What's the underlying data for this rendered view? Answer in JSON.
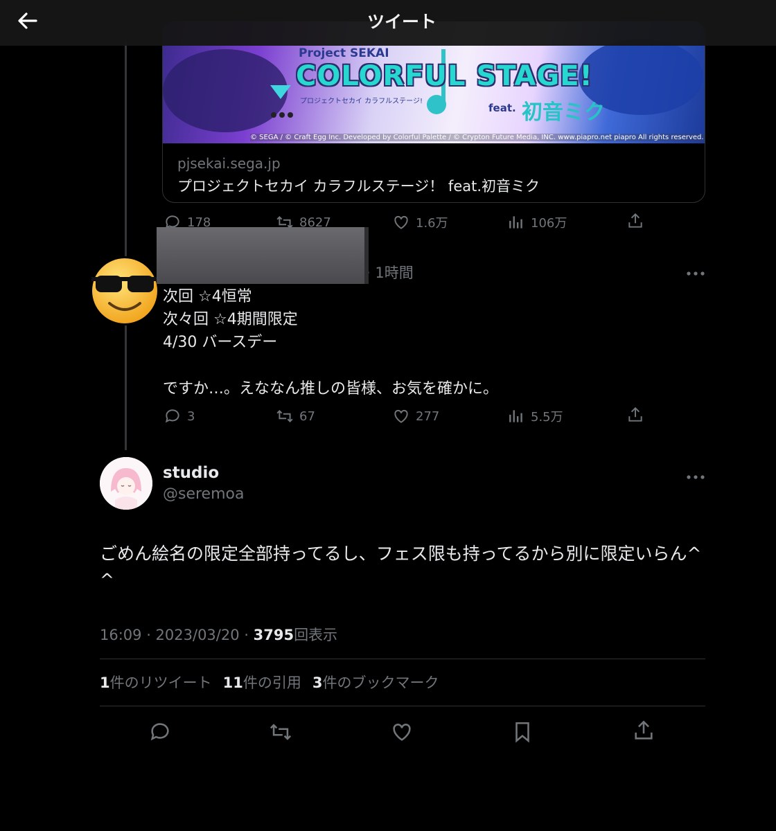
{
  "header": {
    "title": "ツイート"
  },
  "card": {
    "image_text": {
      "project": "Project SEKAI",
      "title": "COLORFUL STAGE!",
      "subtitle": "プロジェクトセカイ カラフルステージ!",
      "feat": "feat.",
      "miku": "初音ミク",
      "copyright": "© SEGA / © Craft Egg Inc. Developed by Colorful Palette / © Crypton Future Media, INC. www.piapro.net piapro All rights reserved."
    },
    "domain": "pjsekai.sega.jp",
    "title": "プロジェクトセカイ カラフルステージ！ feat.初音ミク"
  },
  "tweet1": {
    "replies": "178",
    "retweets": "8627",
    "likes": "1.6万",
    "views": "106万"
  },
  "tweet2": {
    "time": "· 1時間",
    "lines": [
      "次回 ☆4恒常",
      "次々回 ☆4期間限定",
      "4/30 バースデー",
      "ですか…。えななん推しの皆様、お気を確かに。"
    ],
    "replies": "3",
    "retweets": "67",
    "likes": "277",
    "views": "5.5万"
  },
  "main": {
    "display_name": "studio",
    "handle": "@seremoa",
    "text": "ごめん絵名の限定全部持ってるし、フェス限も持ってるから別に限定いらん^ ^",
    "time": "16:09 · 2023/03/20 · ",
    "views_count": "3795",
    "views_label": "回表示",
    "retweets_count": "1",
    "retweets_label": "件のリツイート",
    "quotes_count": "11",
    "quotes_label": "件の引用",
    "bookmarks_count": "3",
    "bookmarks_label": "件のブックマーク"
  },
  "colors": {
    "background": "#000000",
    "text": "#e7e9ea",
    "secondary": "#71767b",
    "divider": "#2f3336"
  }
}
